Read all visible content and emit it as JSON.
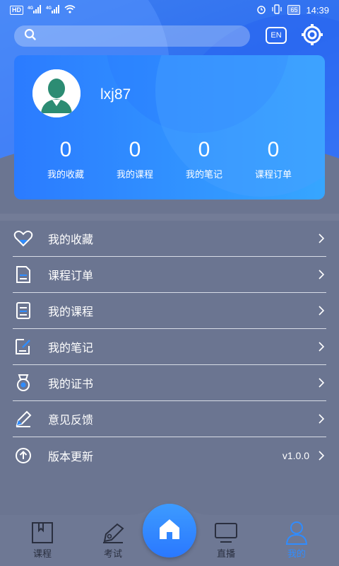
{
  "status_bar": {
    "left_badges": [
      "HD",
      "4G",
      "4G"
    ],
    "battery": "65",
    "time": "14:39"
  },
  "search": {
    "placeholder": ""
  },
  "header": {
    "lang_label": "EN"
  },
  "profile": {
    "username": "lxj87",
    "stats": [
      {
        "value": "0",
        "label": "我的收藏"
      },
      {
        "value": "0",
        "label": "我的课程"
      },
      {
        "value": "0",
        "label": "我的笔记"
      },
      {
        "value": "0",
        "label": "课程订单"
      }
    ]
  },
  "menu": [
    {
      "label": "我的收藏",
      "icon": "heart-icon",
      "extra": ""
    },
    {
      "label": "课程订单",
      "icon": "order-icon",
      "extra": ""
    },
    {
      "label": "我的课程",
      "icon": "course-icon",
      "extra": ""
    },
    {
      "label": "我的笔记",
      "icon": "note-icon",
      "extra": ""
    },
    {
      "label": "我的证书",
      "icon": "certificate-icon",
      "extra": ""
    },
    {
      "label": "意见反馈",
      "icon": "pencil-icon",
      "extra": ""
    },
    {
      "label": "版本更新",
      "icon": "upload-icon",
      "extra": "v1.0.0"
    }
  ],
  "tabbar": {
    "tabs": [
      {
        "label": "课程",
        "icon": "book-icon"
      },
      {
        "label": "考试",
        "icon": "pen-icon"
      },
      {
        "label": "直播",
        "icon": "tv-icon"
      },
      {
        "label": "我的",
        "icon": "user-icon"
      }
    ],
    "active": "我的"
  },
  "colors": {
    "accent": "#2f8cff",
    "menu_bg": "#6b7591",
    "card_start": "#2b7bff",
    "card_end": "#36a6ff"
  }
}
